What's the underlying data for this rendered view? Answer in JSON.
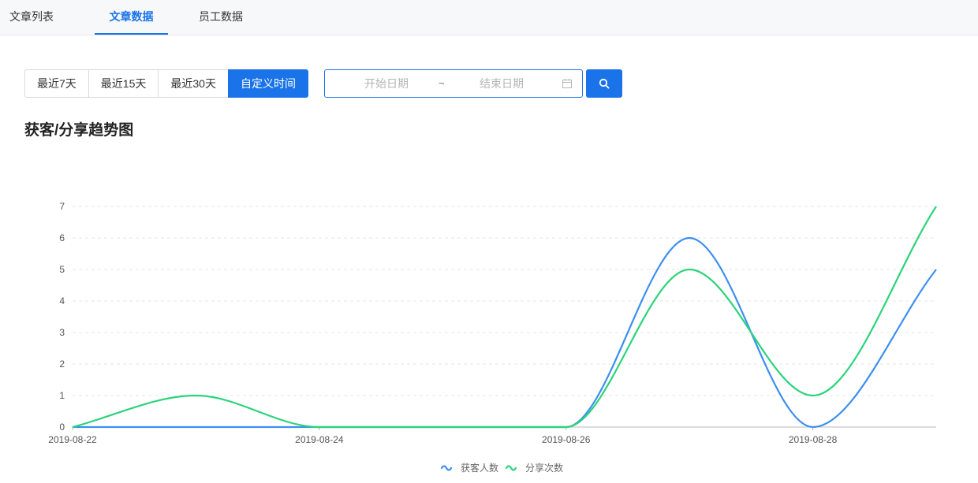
{
  "tabs": [
    {
      "label": "文章列表",
      "active": false
    },
    {
      "label": "文章数据",
      "active": true
    },
    {
      "label": "员工数据",
      "active": false
    }
  ],
  "filters": {
    "ranges": [
      {
        "label": "最近7天",
        "active": false
      },
      {
        "label": "最近15天",
        "active": false
      },
      {
        "label": "最近30天",
        "active": false
      },
      {
        "label": "自定义时间",
        "active": true
      }
    ],
    "start_placeholder": "开始日期",
    "separator": "~",
    "end_placeholder": "结束日期"
  },
  "section": {
    "title": "获客/分享趋势图"
  },
  "colors": {
    "accent": "#1a73e8",
    "series_blue": "#3d8ef0",
    "series_green": "#2bd47a"
  },
  "icons": {
    "search": "search-icon",
    "calendar": "calendar-icon"
  },
  "chart_data": {
    "type": "line",
    "x": [
      "2019-08-22",
      "2019-08-23",
      "2019-08-24",
      "2019-08-25",
      "2019-08-26",
      "2019-08-27",
      "2019-08-28",
      "2019-08-29"
    ],
    "x_tick_labels": [
      "2019-08-22",
      "2019-08-24",
      "2019-08-26",
      "2019-08-28"
    ],
    "ylim": [
      0,
      7
    ],
    "y_ticks": [
      0,
      1,
      2,
      3,
      4,
      5,
      6,
      7
    ],
    "grid": true,
    "smooth": true,
    "legend_position": "bottom-center",
    "series": [
      {
        "name": "获客人数",
        "color": "#3d8ef0",
        "values": [
          0,
          0,
          0,
          0,
          0,
          6,
          0,
          5
        ]
      },
      {
        "name": "分享次数",
        "color": "#2bd47a",
        "values": [
          0,
          1,
          0,
          0,
          0,
          5,
          1,
          7
        ]
      }
    ]
  }
}
